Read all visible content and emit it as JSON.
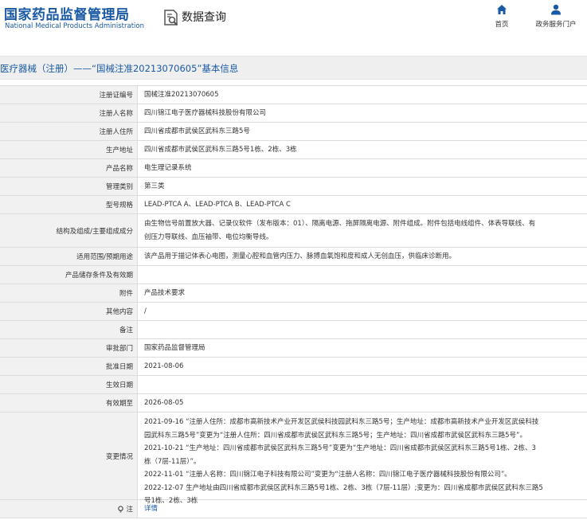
{
  "header": {
    "logo_cn": "国家药品监督管理局",
    "logo_en": "National Medical Products Administration",
    "section": "数据查询",
    "nav_home": "首页",
    "nav_service": "政务服务门户"
  },
  "title": "医疗器械（注册）——“国械注准20213070605”基本信息",
  "rows": [
    {
      "label": "注册证编号",
      "value": "国械注准20213070605"
    },
    {
      "label": "注册人名称",
      "value": "四川锦江电子医疗器械科技股份有限公司"
    },
    {
      "label": "注册人住所",
      "value": "四川省成都市武侯区武科东三路5号"
    },
    {
      "label": "生产地址",
      "value": "四川省成都市武侯区武科东三路5号1栋、2栋、3栋"
    },
    {
      "label": "产品名称",
      "value": "电生理记录系统"
    },
    {
      "label": "管理类别",
      "value": "第三类"
    },
    {
      "label": "型号规格",
      "value": "LEAD-PTCA A、LEAD-PTCA B、LEAD-PTCA C"
    },
    {
      "label": "结构及组成/主要组成成分",
      "lines": [
        "由生物信号前置放大器、记录仪软件（发布版本：01）、隔离电源、拖屏隔离电源、附件组成。附件包括电线组件、体表导联线、有",
        "创压力导联线、血压袖带、电位均衡导线。"
      ]
    },
    {
      "label": "适用范围/预期用途",
      "value": "该产品用于描记体表心电图，测量心腔和血管内压力、脉搏血氧饱和度和成人无创血压，供临床诊断用。"
    },
    {
      "label": "产品储存条件及有效期",
      "value": ""
    },
    {
      "label": "附件",
      "value": "产品技术要求"
    },
    {
      "label": "其他内容",
      "value": "/"
    },
    {
      "label": "备注",
      "value": ""
    },
    {
      "label": "审批部门",
      "value": "国家药品监督管理局"
    },
    {
      "label": "批准日期",
      "value": "2021-08-06"
    },
    {
      "label": "生效日期",
      "value": ""
    },
    {
      "label": "有效期至",
      "value": "2026-08-05"
    },
    {
      "label": "变更情况",
      "lines": [
        "2021-09-16 “注册人住所：成都市高新技术产业开发区武侯科技园武科东三路5号；生产地址：成都市高新技术产业开发区武侯科技",
        "园武科东三路5号”变更为“注册人住所：四川省成都市武侯区武科东三路5号；生产地址：四川省成都市武侯区武科东三路5号”。",
        "2021-10-21 “生产地址：四川省成都市武侯区武科东三路5号”变更为“生产地址：四川省成都市武侯区武科东三路5号1栋、2栋、3",
        "栋（7层-11层）”。",
        "2022-11-01 “注册人名称：四川锦江电子科技有限公司”变更为“注册人名称：四川锦江电子医疗器械科技股份有限公司”。",
        "2022-12-07 生产地址由四川省成都市武侯区武科东三路5号1栋、2栋、3栋（7层-11层）;变更为：四川省成都市武侯区武科东三路5",
        "号1栋、2栋、3栋"
      ]
    },
    {
      "label": "注",
      "value": "详情"
    }
  ],
  "colors": {
    "brand": "#1a5aa5",
    "label_bg": "#f1f1f1",
    "border": "#dcdcdc"
  }
}
